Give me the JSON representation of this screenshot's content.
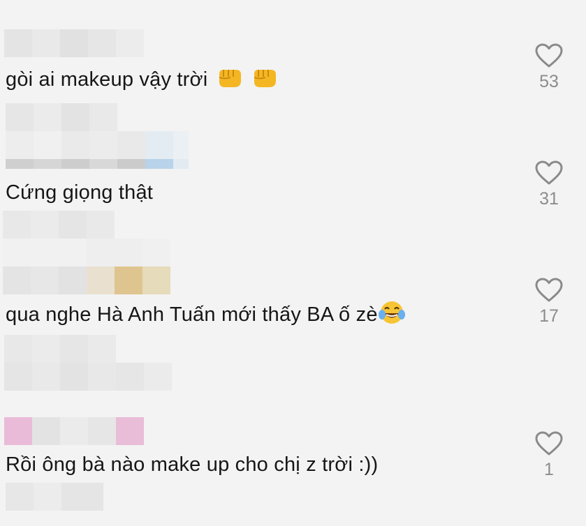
{
  "comments": [
    {
      "text": "gòi ai makeup vậy trời",
      "likes": "53"
    },
    {
      "text": "Cứng giọng thật",
      "likes": "31"
    },
    {
      "text": "qua nghe Hà Anh Tuấn mới thấy BA ố zè",
      "likes": "17"
    },
    {
      "text": "Rồi ông bà nào make up cho chị z trời :))",
      "likes": "1"
    }
  ],
  "icons": {
    "like": "heart-outline-icon",
    "fist": "oncoming-fist-emoji",
    "laugh": "tears-of-joy-emoji"
  },
  "colors": {
    "background": "#f3f3f3",
    "text": "#161616",
    "count": "#8c8c8c",
    "heart_stroke": "#8a8a8a",
    "emoji_fist": "#f5b623",
    "emoji_laugh": "#f7c534"
  }
}
